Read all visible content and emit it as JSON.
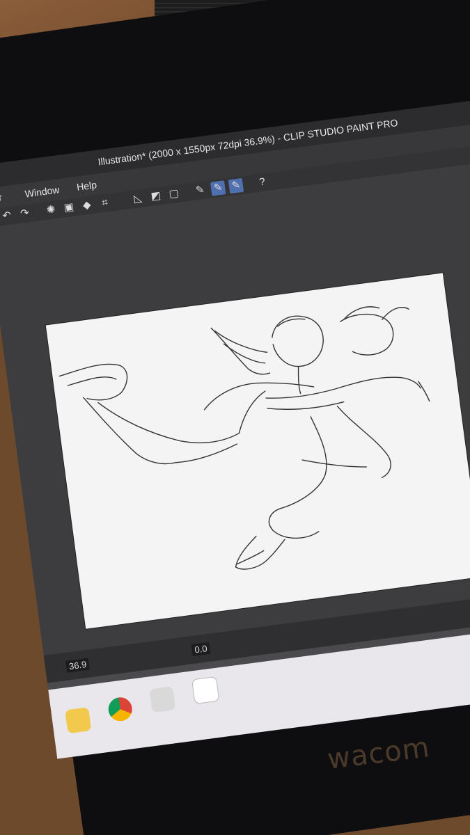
{
  "window": {
    "title": "Illustration* (2000 x 1550px 72dpi 36.9%)  - CLIP STUDIO PAINT PRO"
  },
  "menu": {
    "items": [
      "ilter",
      "Window",
      "Help"
    ]
  },
  "status": {
    "zoom": "36.9",
    "rotation": "0.0"
  },
  "brand": {
    "wacom": "wacom"
  },
  "colors": {
    "canvas": "#f3f4f3",
    "ui_dark": "#3d3d40",
    "active_tool": "#4f6fae"
  }
}
